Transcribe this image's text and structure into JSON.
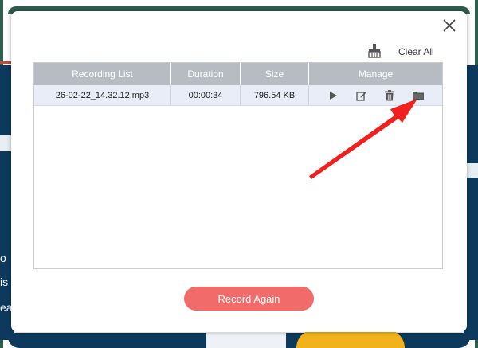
{
  "dialog": {
    "clear_all_label": "Clear All",
    "record_again_label": "Record Again"
  },
  "table": {
    "headers": [
      "Recording List",
      "Duration",
      "Size",
      "Manage"
    ],
    "rows": [
      {
        "name": "26-02-22_14.32.12.mp3",
        "duration": "00:00:34",
        "size": "796.54 KB"
      }
    ]
  },
  "background": {
    "left_text": [
      "o",
      "is",
      "ea"
    ]
  },
  "icons": {
    "close": "close-icon",
    "clear": "broom-icon",
    "play": "play-icon",
    "edit": "edit-icon",
    "delete": "trash-icon",
    "folder": "folder-icon",
    "annotation": "red-arrow"
  },
  "colors": {
    "header_bg": "#b7bcc3",
    "row_bg": "#e9edf7",
    "record_button": "#f26b6b",
    "arrow": "#f0201e",
    "background_app": "#0d3a5c"
  }
}
